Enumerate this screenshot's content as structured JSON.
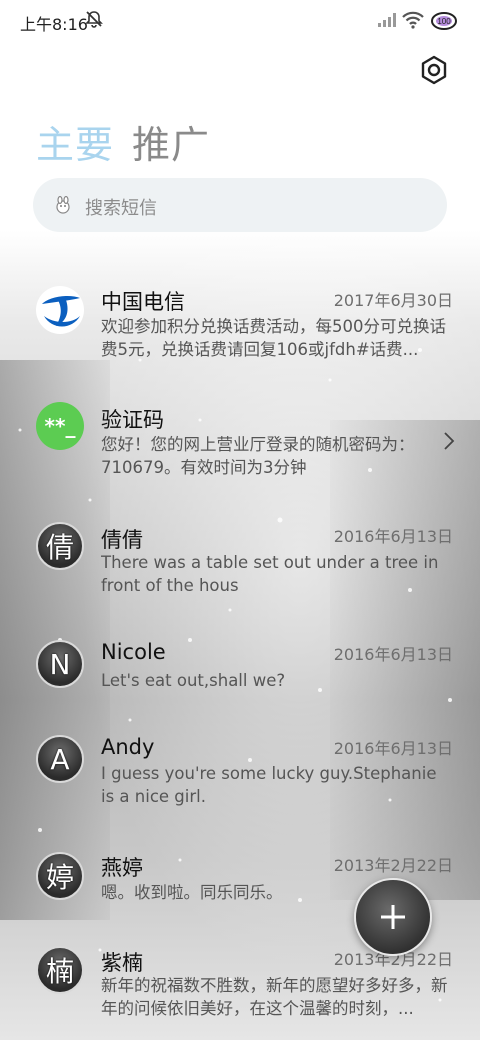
{
  "status_bar": {
    "time": "上午8:16",
    "battery": "100"
  },
  "tabs": {
    "primary": "主要",
    "promotions": "推广"
  },
  "search": {
    "placeholder": "搜索短信"
  },
  "conversations": [
    {
      "avatar": "",
      "avatar_type": "china-telecom-logo",
      "name": "中国电信",
      "date": "2017年6月30日",
      "preview": "欢迎参加积分兑换话费活动，每500分可兑换话费5元，兑换话费请回复106或jfdh#话费..."
    },
    {
      "avatar": "**_",
      "avatar_type": "green",
      "name": "验证码",
      "date": "",
      "preview": "您好！您的网上营业厅登录的随机密码为：710679。有效时间为3分钟"
    },
    {
      "avatar": "倩",
      "avatar_type": "letter",
      "name": "倩倩",
      "date": "2016年6月13日",
      "preview": "There was a table set out under a tree in front of the hous"
    },
    {
      "avatar": "N",
      "avatar_type": "letter",
      "name": "Nicole",
      "date": "2016年6月13日",
      "preview": "Let's eat out,shall we?"
    },
    {
      "avatar": "A",
      "avatar_type": "letter",
      "name": "Andy",
      "date": "2016年6月13日",
      "preview": "I guess you're some lucky guy.Stephanie is a nice girl."
    },
    {
      "avatar": "婷",
      "avatar_type": "letter",
      "name": "燕婷",
      "date": "2013年2月22日",
      "preview": "嗯。收到啦。同乐同乐。"
    },
    {
      "avatar": "楠",
      "avatar_type": "letter",
      "name": "紫楠",
      "date": "2013年2月22日",
      "preview": "新年的祝福数不胜数，新年的愿望好多好多，新年的问候依旧美好，在这个温馨的时刻，..."
    }
  ],
  "colors": {
    "tab_active": "#a9d4ee",
    "tab_inactive": "#8a8a8a",
    "search_bg": "#eef2f4",
    "verify_green": "#5ccc52",
    "telecom_blue": "#0b5fbf"
  },
  "icons": {
    "settings": "gear-icon",
    "fab": "plus-icon",
    "search": "search-mascot-icon",
    "chevron": "chevron-right-icon"
  }
}
